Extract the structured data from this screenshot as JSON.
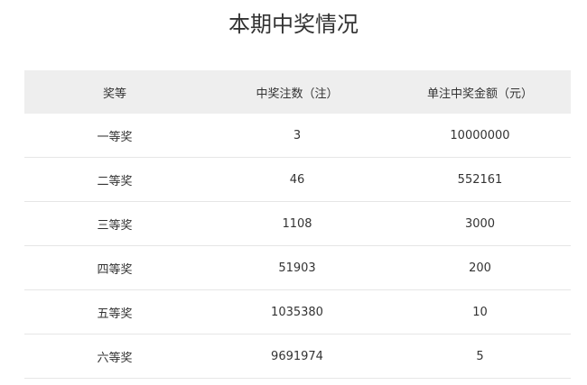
{
  "page": {
    "title": "本期中奖情况"
  },
  "table": {
    "headers": [
      "奖等",
      "中奖注数（注）",
      "单注中奖金额（元）"
    ],
    "rows": [
      {
        "level": "一等奖",
        "count": "3",
        "amount": "10000000"
      },
      {
        "level": "二等奖",
        "count": "46",
        "amount": "552161"
      },
      {
        "level": "三等奖",
        "count": "1108",
        "amount": "3000"
      },
      {
        "level": "四等奖",
        "count": "51903",
        "amount": "200"
      },
      {
        "level": "五等奖",
        "count": "1035380",
        "amount": "10"
      },
      {
        "level": "六等奖",
        "count": "9691974",
        "amount": "5"
      }
    ]
  },
  "colors": {
    "header_background": "#eeeeee",
    "row_divider": "#e6e6e6",
    "text": "#333333"
  }
}
